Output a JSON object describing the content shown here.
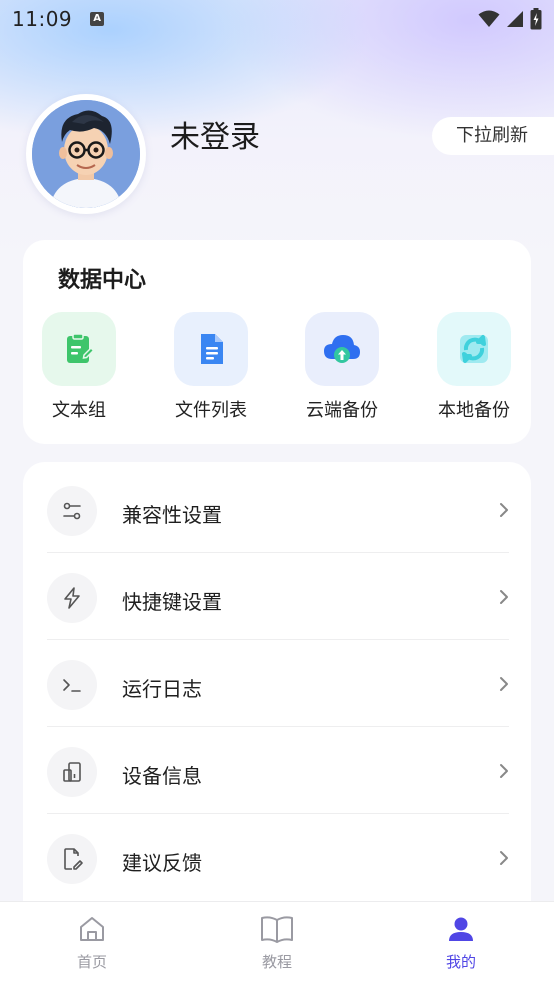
{
  "status_bar": {
    "time": "11:09",
    "notification_badge": "A",
    "icons": [
      "wifi-icon",
      "signal-icon",
      "battery-charging-icon"
    ]
  },
  "profile": {
    "username": "未登录",
    "refresh_hint": "下拉刷新"
  },
  "data_center": {
    "title": "数据中心",
    "items": [
      {
        "label": "文本组",
        "icon": "note-edit-icon",
        "bg": "#e6f8ec",
        "color": "#3ec56b"
      },
      {
        "label": "文件列表",
        "icon": "document-icon",
        "bg": "#e8f0fd",
        "color": "#3a86f2"
      },
      {
        "label": "云端备份",
        "icon": "cloud-upload-icon",
        "bg": "#e9eefc",
        "color": "#2f6ff0"
      },
      {
        "label": "本地备份",
        "icon": "sync-icon",
        "bg": "#e3f9fa",
        "color": "#3fd1dc"
      }
    ]
  },
  "menu": {
    "items": [
      {
        "label": "兼容性设置",
        "icon": "sliders-icon"
      },
      {
        "label": "快捷键设置",
        "icon": "lightning-icon"
      },
      {
        "label": "运行日志",
        "icon": "terminal-icon"
      },
      {
        "label": "设备信息",
        "icon": "device-info-icon"
      },
      {
        "label": "建议反馈",
        "icon": "feedback-edit-icon"
      }
    ]
  },
  "bottom_nav": {
    "items": [
      {
        "label": "首页",
        "icon": "home-icon",
        "active": false
      },
      {
        "label": "教程",
        "icon": "book-icon",
        "active": false
      },
      {
        "label": "我的",
        "icon": "user-icon",
        "active": true
      }
    ],
    "active_color": "#5046e5",
    "inactive_color": "#9a9aa2"
  }
}
